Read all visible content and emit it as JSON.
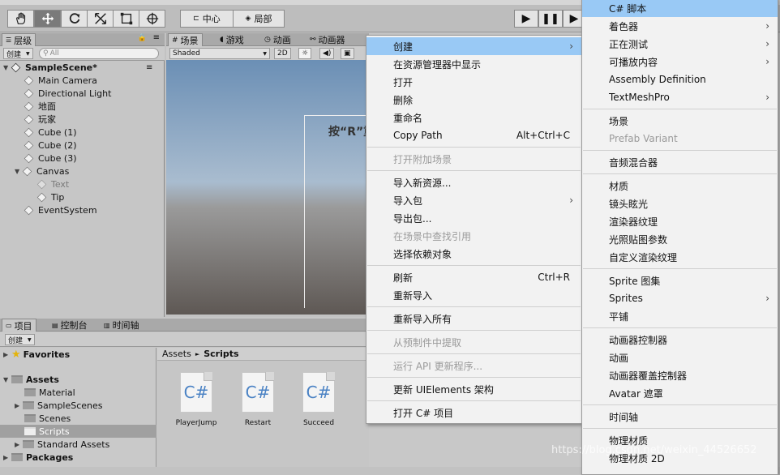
{
  "toolbar": {
    "pivot": "中心",
    "space": "局部"
  },
  "hierarchy": {
    "tab": "层级",
    "create": "创建",
    "search_placeholder": "All",
    "scene": "SampleScene*",
    "items": [
      "Main Camera",
      "Directional Light",
      "地面",
      "玩家",
      "Cube (1)",
      "Cube (2)",
      "Cube (3)",
      "Canvas",
      "Text",
      "Tip",
      "EventSystem"
    ]
  },
  "scene_tabs": {
    "scene": "场景",
    "game": "游戏",
    "animation": "动画",
    "animator": "动画器",
    "shading": "Shaded",
    "mode2d": "2D",
    "overlay_text": "按“R”重"
  },
  "project": {
    "tab_project": "项目",
    "tab_console": "控制台",
    "tab_timeline": "时间轴",
    "create": "创建",
    "favorites": "Favorites",
    "assets": "Assets",
    "folders": [
      "Material",
      "SampleScenes",
      "Scenes",
      "Scripts",
      "Standard Assets"
    ],
    "packages": "Packages",
    "breadcrumb_root": "Assets",
    "breadcrumb_sep": "►",
    "breadcrumb_leaf": "Scripts",
    "files": [
      {
        "icon": "C#",
        "name": "PlayerJump"
      },
      {
        "icon": "C#",
        "name": "Restart"
      },
      {
        "icon": "C#",
        "name": "Succeed"
      }
    ]
  },
  "context_menu": {
    "items": [
      {
        "label": "创建",
        "arrow": "›"
      },
      {
        "label": "在资源管理器中显示"
      },
      {
        "label": "打开"
      },
      {
        "label": "删除"
      },
      {
        "label": "重命名"
      },
      {
        "label": "Copy Path",
        "shortcut": "Alt+Ctrl+C"
      },
      {
        "label": "打开附加场景"
      },
      {
        "label": "导入新资源..."
      },
      {
        "label": "导入包",
        "arrow": "›"
      },
      {
        "label": "导出包..."
      },
      {
        "label": "在场景中查找引用"
      },
      {
        "label": "选择依赖对象"
      },
      {
        "label": "刷新",
        "shortcut": "Ctrl+R"
      },
      {
        "label": "重新导入"
      },
      {
        "label": "重新导入所有"
      },
      {
        "label": "从预制件中提取"
      },
      {
        "label": "运行 API 更新程序..."
      },
      {
        "label": "更新 UIElements 架构"
      },
      {
        "label": "打开 C# 项目"
      }
    ]
  },
  "submenu": {
    "items": [
      {
        "label": "C# 脚本"
      },
      {
        "label": "着色器",
        "arrow": "›"
      },
      {
        "label": "正在测试",
        "arrow": "›"
      },
      {
        "label": "可播放内容",
        "arrow": "›"
      },
      {
        "label": "Assembly Definition"
      },
      {
        "label": "TextMeshPro",
        "arrow": "›"
      },
      {
        "label": "场景"
      },
      {
        "label": "Prefab Variant"
      },
      {
        "label": "音频混合器"
      },
      {
        "label": "材质"
      },
      {
        "label": "镜头眩光"
      },
      {
        "label": "渲染器纹理"
      },
      {
        "label": "光照贴图参数"
      },
      {
        "label": "自定义渲染纹理"
      },
      {
        "label": "Sprite 图集"
      },
      {
        "label": "Sprites",
        "arrow": "›"
      },
      {
        "label": "平铺"
      },
      {
        "label": "动画器控制器"
      },
      {
        "label": "动画"
      },
      {
        "label": "动画器覆盖控制器"
      },
      {
        "label": "Avatar 遮罩"
      },
      {
        "label": "时间轴"
      },
      {
        "label": "物理材质"
      },
      {
        "label": "物理材质 2D"
      }
    ]
  },
  "watermark": "https://blog.csdn.net/weixin_44526652"
}
